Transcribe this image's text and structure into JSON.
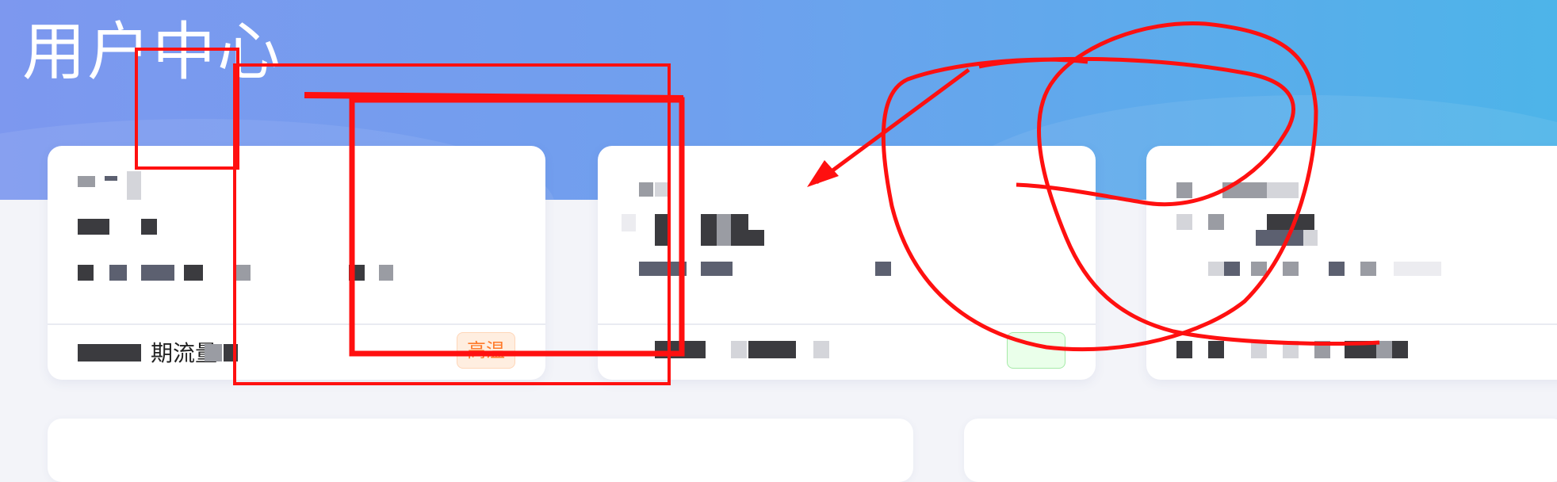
{
  "header": {
    "title": "用户中心"
  },
  "cards": [
    {
      "footer_label": "期流量",
      "tag": "高温"
    },
    {
      "tag": ""
    },
    {}
  ],
  "colors": {
    "header_start": "#7d98ef",
    "header_end": "#4db4e9",
    "annotation": "#ff0000",
    "tag_orange": "#ff7a2a",
    "tag_green": "#31b34a"
  }
}
